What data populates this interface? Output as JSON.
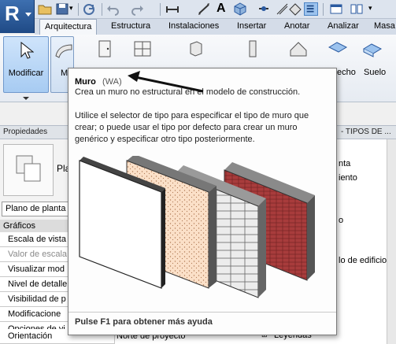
{
  "app": {
    "logo_letter": "R"
  },
  "tabs": [
    {
      "label": "Arquitectura",
      "active": true
    },
    {
      "label": "Estructura"
    },
    {
      "label": "Instalaciones"
    },
    {
      "label": "Insertar"
    },
    {
      "label": "Anotar"
    },
    {
      "label": "Analizar"
    },
    {
      "label": "Masa"
    }
  ],
  "ribbon": {
    "modificar_label": "Modificar",
    "muro_label": "M",
    "techo_label": "echo",
    "suelo_label": "Suelo"
  },
  "palette_bar": {
    "properties_title": "Propiedades",
    "tipos_title": "- TIPOS DE ..."
  },
  "properties": {
    "type_name": "Pla",
    "type_selector": "Plano de planta",
    "section": "Gráficos",
    "rows": [
      {
        "label": "Escala de vista",
        "gray": false
      },
      {
        "label": "Valor de escala",
        "gray": true
      },
      {
        "label": "Visualizar mod",
        "gray": false
      },
      {
        "label": "Nivel de detalle",
        "gray": false
      },
      {
        "label": "Visibilidad de p",
        "gray": false
      },
      {
        "label": "Modificacione",
        "gray": false
      },
      {
        "label": "Opciones de vi",
        "gray": false
      },
      {
        "label": "Orientación",
        "gray": false
      }
    ],
    "orientation_value": "Norte de proyecto"
  },
  "browser": {
    "items": [
      "nta",
      "iento",
      "o",
      "lo de edificio)",
      "Leyendas"
    ]
  },
  "tooltip": {
    "title": "Muro",
    "code": "(WA)",
    "description": "Crea un muro no estructural en el modelo de construcción.",
    "body": "Utilice el selector de tipo para especificar el tipo de muro que crear; o puede usar el tipo por defecto para crear un muro genérico y especificar otro tipo posteriormente.",
    "footer": "Pulse F1 para obtener más ayuda"
  },
  "colors": {
    "accent_blue": "#2a5aa0",
    "tooltip_border": "#7b7b7b",
    "brick": "#a83c3c"
  }
}
